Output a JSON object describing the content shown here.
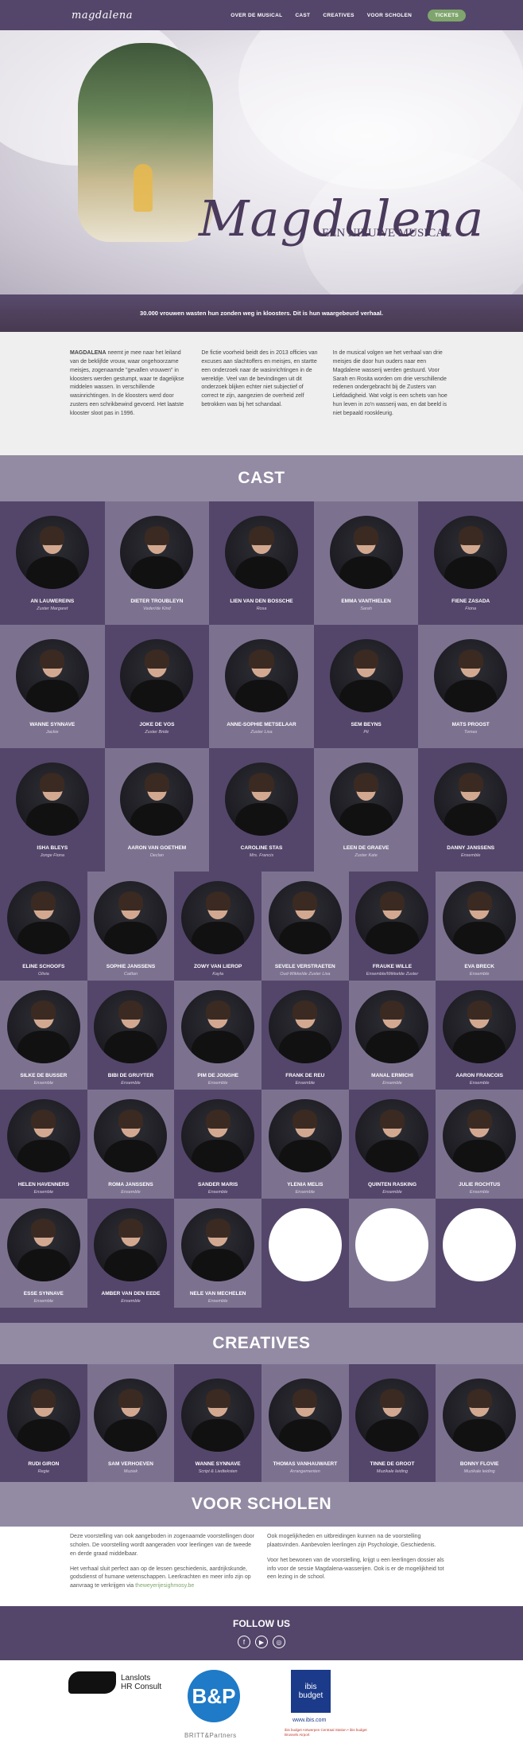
{
  "nav": {
    "logo": "magdalena",
    "items": [
      "OVER DE MUSICAL",
      "CAST",
      "CREATIVES",
      "VOOR SCHOLEN"
    ],
    "tickets": "TICKETS"
  },
  "hero": {
    "title": "Magdalena",
    "subtitle": "EEN NIEUWE MUSICAL"
  },
  "banner": "30.000 vrouwen wasten hun zonden weg in kloosters. Dit is hun waargebeurd verhaal.",
  "intro": {
    "col1_strong": "MAGDALENA",
    "col1": " neemt je mee naar het leiland van de beklijfde vrouw, waar ongehoorzame meisjes, zogenaamde \"gevallen vrouwen\" in kloosters werden gestumpt, waar te dagelijkse middelen wassen. In verschillende wasinrichtingen. In de kloosters werd door zusters een schrikbewind gevoerd. Het laatste klooster sloot pas in 1996.",
    "col2": "De fictie voorheid beidt des in 2013 officies van excuses aan slachtoffers en meisjes, en startte een onderzoek naar de wasinrichtingen in de wereldije. Veel van de bevindingen uit dit onderzoek blijken echter niet subjectief of correct te zijn, aangezien de overheid zelf betrokken was bij het schandaal.",
    "col3": "In de musical volgen we het verhaal van drie meisjes die door hun ouders naar een Magdalene wasserij werden gestuurd. Voor Sarah en Rosita worden om drie verschillende redenen ondergebracht bij de Zusters van Liefdadigheid. Wat volgt is een schets van hoe hun leven in zo'n wasserij was, en dat beeld is niet bepaald rooskleurig."
  },
  "cast_heading": "CAST",
  "cast": [
    {
      "name": "AN LAUWEREINS",
      "role": "Zuster Margaret"
    },
    {
      "name": "DIETER TROUBLEYN",
      "role": "Vader/de Kind"
    },
    {
      "name": "LIEN VAN DEN BOSSCHE",
      "role": "Rosa"
    },
    {
      "name": "EMMA VANTHIELEN",
      "role": "Sarah"
    },
    {
      "name": "FIENE ZASADA",
      "role": "Fiona"
    },
    {
      "name": "WANNE SYNNAVE",
      "role": "Jackie"
    },
    {
      "name": "JOKE DE VOS",
      "role": "Zuster Bride"
    },
    {
      "name": "ANNE-SOPHIE METSELAAR",
      "role": "Zuster Lisa"
    },
    {
      "name": "SEM BEYNS",
      "role": "Pit"
    },
    {
      "name": "MATS PROOST",
      "role": "Tomas"
    },
    {
      "name": "ISHA BLEYS",
      "role": "Jonge Fiona"
    },
    {
      "name": "AARON VAN GOETHEM",
      "role": "Declan"
    },
    {
      "name": "CAROLINE STAS",
      "role": "Mrs. Francis"
    },
    {
      "name": "LEEN DE GRAEVE",
      "role": "Zuster Kate"
    },
    {
      "name": "DANNY JANSSENS",
      "role": "Ensemble"
    },
    {
      "name": "ELINE SCHOOFS",
      "role": "Olivia"
    },
    {
      "name": "SOPHIE JANSSENS",
      "role": "Caitlan"
    },
    {
      "name": "ZOWY VAN LIEROP",
      "role": "Kayla"
    },
    {
      "name": "SEVELE VERSTRAETEN",
      "role": "Oud-Wikkelde Zuster Lisa"
    },
    {
      "name": "FRAUKE WILLE",
      "role": "Ensemble/Wikkelde Zuster"
    },
    {
      "name": "EVA BRECK",
      "role": "Ensemble"
    },
    {
      "name": "SILKE DE BUSSER",
      "role": "Ensemble"
    },
    {
      "name": "BIBI DE GRUYTER",
      "role": "Ensemble"
    },
    {
      "name": "PIM DE JONGHE",
      "role": "Ensemble"
    },
    {
      "name": "FRANK DE REU",
      "role": "Ensemble"
    },
    {
      "name": "MANAL ERMICHI",
      "role": "Ensemble"
    },
    {
      "name": "AARON FRANCOIS",
      "role": "Ensemble"
    },
    {
      "name": "HELEN HAVENNERS",
      "role": "Ensemble"
    },
    {
      "name": "ROMA JANSSENS",
      "role": "Ensemble"
    },
    {
      "name": "SANDER MARIS",
      "role": "Ensemble"
    },
    {
      "name": "YLENIA MELIS",
      "role": "Ensemble"
    },
    {
      "name": "QUINTEN RASKING",
      "role": "Ensemble"
    },
    {
      "name": "JULIE ROCHTUS",
      "role": "Ensemble"
    },
    {
      "name": "ESSE SYNNAVE",
      "role": "Ensemble"
    },
    {
      "name": "AMBER VAN DEN EEDE",
      "role": "Ensemble"
    },
    {
      "name": "NELE VAN MECHELEN",
      "role": "Ensemble"
    },
    {
      "name": "",
      "role": ""
    },
    {
      "name": "",
      "role": ""
    },
    {
      "name": "",
      "role": ""
    }
  ],
  "creatives_heading": "CREATIVES",
  "creatives": [
    {
      "name": "RUDI GIRON",
      "role": "Regie"
    },
    {
      "name": "SAM VERHOEVEN",
      "role": "Muziek"
    },
    {
      "name": "WANNE SYNNAVE",
      "role": "Script & Liedteksten"
    },
    {
      "name": "THOMAS VANHAUWAERT",
      "role": "Arrangementen"
    },
    {
      "name": "TINNE DE GROOT",
      "role": "Muzikale leiding"
    },
    {
      "name": "BONNY FLOVIE",
      "role": "Muzikale leiding"
    }
  ],
  "schools_heading": "VOOR SCHOLEN",
  "schools": {
    "col1a": "Deze voorstelling van ook aangeboden in zogenaamde voorstellingen door scholen. De voorstelling wordt aangeraden voor leerlingen van de tweede en derde graad middelbaar.",
    "col1b": "Het verhaal sluit perfect aan op de lessen geschiedenis, aardrijkskunde, godsdienst of humane wetenschappen. Leerkrachten en meer info zijn op aanvraag te verkrijgen via ",
    "link": "theweyerijesighmosy.be",
    "col2a": "Ook mogelijkheden en uitbreidingen kunnen na de voorstelling plaatsvinden. Aanbevolen leerlingen zijn Psychologie, Geschiedenis.",
    "col2b": "Voor het bewonen van de voorstelling, krijgt u een leerlingen dossier als info voor de sessie Magdalena-wasserijen. Ook is er de mogelijkheid tot een lezing in de school."
  },
  "follow": {
    "heading": "FOLLOW US",
    "icons": [
      "facebook-icon",
      "youtube-icon",
      "instagram-icon"
    ],
    "glyphs": [
      "f",
      "▶",
      "◎"
    ]
  },
  "sponsors": {
    "s1_line1": "Lanslots",
    "s1_line2": "HR Consult",
    "s2": "B&P",
    "s2_caption": "BRITT&Partners",
    "s3_line1": "ibis",
    "s3_line2": "budget",
    "s3_url": "www.ibis.com",
    "s3_small": "ibis budget Antwerpen Centraal Station • ibis budget Brussels Airport"
  },
  "colors": {
    "dark": "#54466a",
    "light": "#938aa3",
    "accent": "#7fa56d"
  }
}
